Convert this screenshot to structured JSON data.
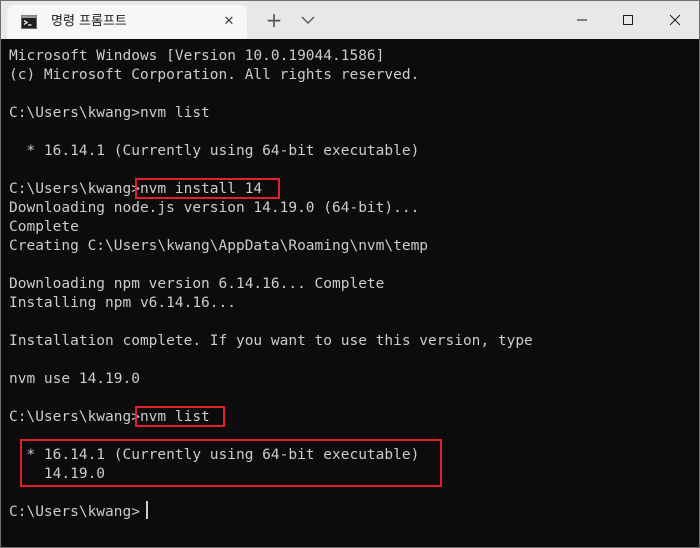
{
  "window": {
    "tab_title": "명령 프롬프트",
    "new_tab_symbol": "+",
    "close_tab_symbol": "✕"
  },
  "terminal": {
    "lines": [
      "Microsoft Windows [Version 10.0.19044.1586]",
      "(c) Microsoft Corporation. All rights reserved.",
      "",
      "C:\\Users\\kwang>nvm list",
      "",
      "  * 16.14.1 (Currently using 64-bit executable)",
      "",
      "C:\\Users\\kwang>nvm install 14",
      "Downloading node.js version 14.19.0 (64-bit)...",
      "Complete",
      "Creating C:\\Users\\kwang\\AppData\\Roaming\\nvm\\temp",
      "",
      "Downloading npm version 6.14.16... Complete",
      "Installing npm v6.14.16...",
      "",
      "Installation complete. If you want to use this version, type",
      "",
      "nvm use 14.19.0",
      "",
      "C:\\Users\\kwang>nvm list",
      "",
      "  * 16.14.1 (Currently using 64-bit executable)",
      "    14.19.0",
      "",
      "C:\\Users\\kwang>"
    ]
  },
  "colors": {
    "terminal_bg": "#0c0c0c",
    "terminal_fg": "#cccccc",
    "highlight": "#e0202a",
    "titlebar_bg": "#e8e8e8",
    "tab_bg": "#f7f7f7"
  }
}
